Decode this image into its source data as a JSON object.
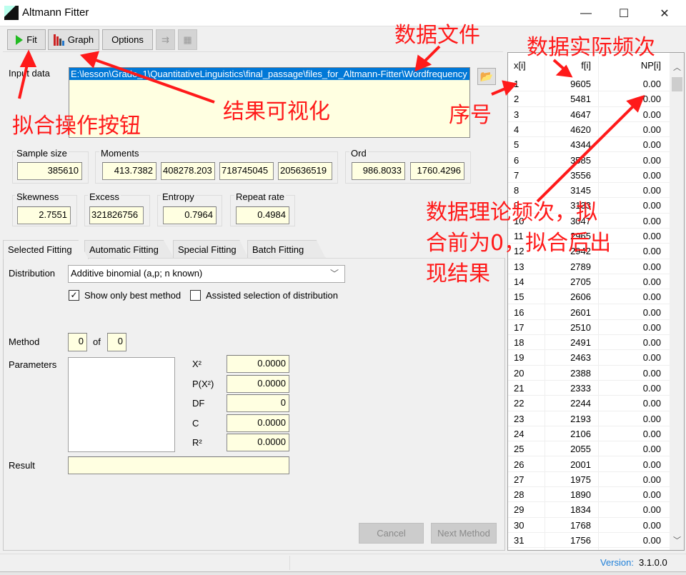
{
  "window": {
    "title": "Altmann Fitter",
    "minimize": "—",
    "maximize": "☐",
    "close": "✕"
  },
  "toolbar": {
    "fit": "Fit",
    "graph": "Graph",
    "options": "Options"
  },
  "input": {
    "label": "Input data",
    "path": "E:\\lesson\\Grade_1\\QuantitativeLinguistics\\final_passage\\files_for_Altmann-Fitter\\Wordfrequency"
  },
  "stats": {
    "sample_size_label": "Sample size",
    "sample_size": "385610",
    "moments_label": "Moments",
    "moments": [
      "413.7382",
      "408278.203",
      "718745045",
      "205636519"
    ],
    "ord_label": "Ord",
    "ord": [
      "986.8033",
      "1760.4296"
    ],
    "skewness_label": "Skewness",
    "skewness": "2.7551",
    "excess_label": "Excess",
    "excess": "321826756",
    "entropy_label": "Entropy",
    "entropy": "0.7964",
    "repeat_label": "Repeat rate",
    "repeat": "0.4984"
  },
  "tabs": [
    "Selected Fitting",
    "Automatic Fitting",
    "Special Fitting",
    "Batch Fitting"
  ],
  "fitting": {
    "distribution_label": "Distribution",
    "distribution": "Additive binomial (a,p; n known)",
    "show_best": "Show only best method",
    "show_best_checked": true,
    "assisted": "Assisted selection of distribution",
    "assisted_checked": false,
    "method_label": "Method",
    "method": "0",
    "of": "of",
    "method_total": "0",
    "parameters_label": "Parameters",
    "result_label": "Result",
    "result": "",
    "metrics": [
      {
        "label": "X²",
        "value": "0.0000"
      },
      {
        "label": "P(X²)",
        "value": "0.0000"
      },
      {
        "label": "DF",
        "value": "0"
      },
      {
        "label": "C",
        "value": "0.0000"
      },
      {
        "label": "R²",
        "value": "0.0000"
      }
    ],
    "cancel": "Cancel",
    "next": "Next Method"
  },
  "table": {
    "headers": [
      "x[i]",
      "f[i]",
      "NP[i]"
    ],
    "rows": [
      [
        1,
        9605,
        "0.00"
      ],
      [
        2,
        5481,
        "0.00"
      ],
      [
        3,
        4647,
        "0.00"
      ],
      [
        4,
        4620,
        "0.00"
      ],
      [
        5,
        4344,
        "0.00"
      ],
      [
        6,
        3585,
        "0.00"
      ],
      [
        7,
        3556,
        "0.00"
      ],
      [
        8,
        3145,
        "0.00"
      ],
      [
        9,
        3133,
        "0.00"
      ],
      [
        10,
        3047,
        "0.00"
      ],
      [
        11,
        2965,
        "0.00"
      ],
      [
        12,
        2942,
        "0.00"
      ],
      [
        13,
        2789,
        "0.00"
      ],
      [
        14,
        2705,
        "0.00"
      ],
      [
        15,
        2606,
        "0.00"
      ],
      [
        16,
        2601,
        "0.00"
      ],
      [
        17,
        2510,
        "0.00"
      ],
      [
        18,
        2491,
        "0.00"
      ],
      [
        19,
        2463,
        "0.00"
      ],
      [
        20,
        2388,
        "0.00"
      ],
      [
        21,
        2333,
        "0.00"
      ],
      [
        22,
        2244,
        "0.00"
      ],
      [
        23,
        2193,
        "0.00"
      ],
      [
        24,
        2106,
        "0.00"
      ],
      [
        25,
        2055,
        "0.00"
      ],
      [
        26,
        2001,
        "0.00"
      ],
      [
        27,
        1975,
        "0.00"
      ],
      [
        28,
        1890,
        "0.00"
      ],
      [
        29,
        1834,
        "0.00"
      ],
      [
        30,
        1768,
        "0.00"
      ],
      [
        31,
        1756,
        "0.00"
      ]
    ]
  },
  "status": {
    "version_label": "Version:",
    "version": "3.1.0.0"
  },
  "annotations": {
    "data_file": "数据文件",
    "actual_freq": "数据实际频次",
    "visualize": "结果可视化",
    "fit_button": "拟合操作按钮",
    "index": "序号",
    "theory_1": "数据理论频次，拟",
    "theory_2": "合前为0，拟合后出",
    "theory_3": "现结果"
  },
  "colors": {
    "annotation": "#ff1a1a",
    "field_bg": "#ffffe1",
    "selection": "#0078d7",
    "version": "#1e7fd8"
  }
}
